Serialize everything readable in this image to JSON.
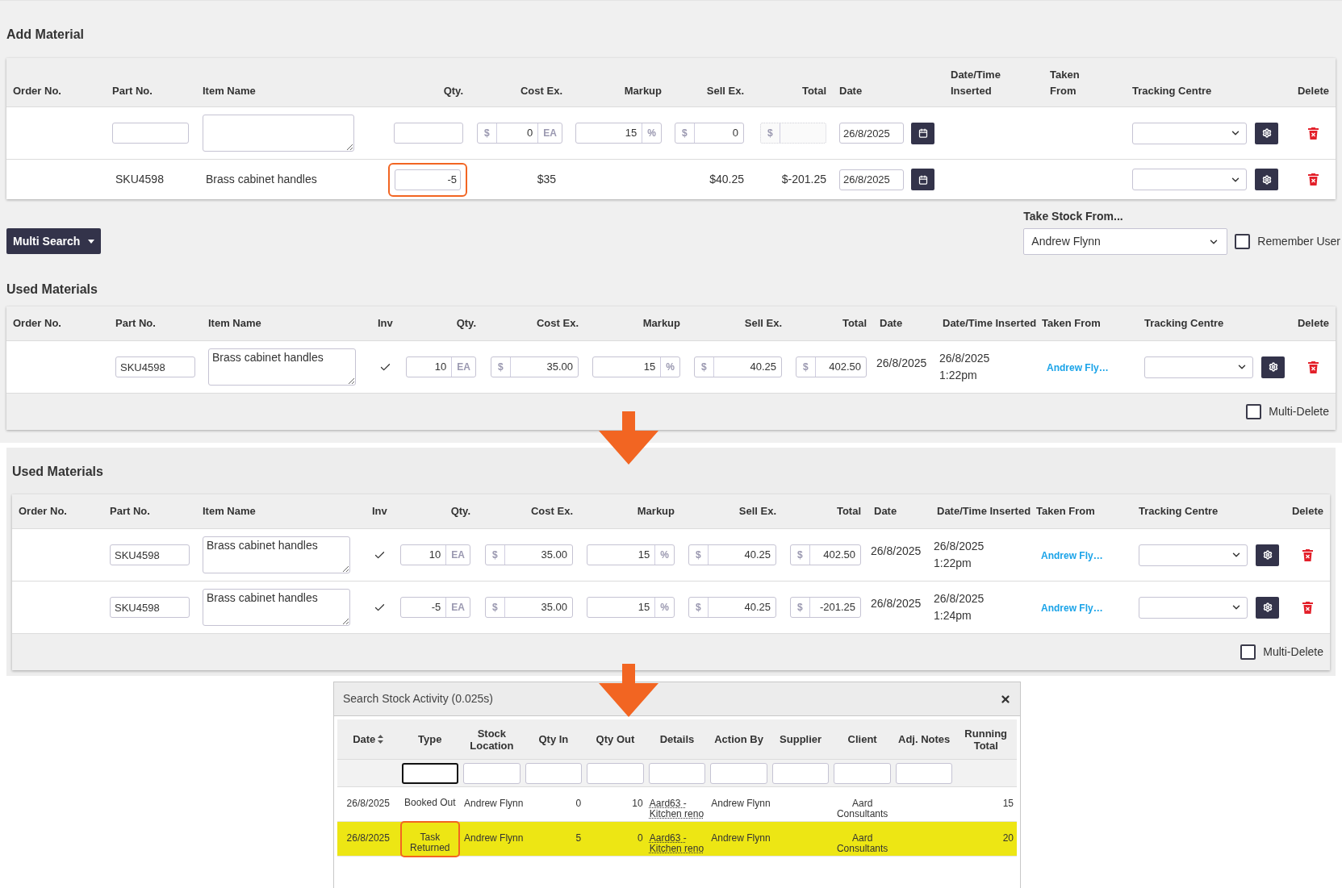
{
  "add_material": {
    "title": "Add Material",
    "columns": [
      "Order No.",
      "Part No.",
      "Item Name",
      "Qty.",
      "Cost Ex.",
      "Markup",
      "Sell Ex.",
      "Total",
      "Date",
      "Date/Time Inserted",
      "Taken From",
      "Tracking Centre",
      "Delete"
    ],
    "entry_row": {
      "cost_ex": {
        "prefix": "$",
        "value": "0",
        "suffix": "EA"
      },
      "markup": {
        "value": "15",
        "suffix": "%"
      },
      "sell_ex": {
        "prefix": "$",
        "value": "0"
      },
      "total": {
        "prefix": "$",
        "disabled": true
      },
      "date": "26/8/2025"
    },
    "rows": [
      {
        "part_no": "SKU4598",
        "item_name": "Brass cabinet handles",
        "qty": "-5",
        "qty_callout": true,
        "cost_ex": "$35",
        "sell_ex": "$40.25",
        "total": "$-201.25",
        "date": "26/8/2025"
      }
    ]
  },
  "multi_search": {
    "label": "Multi Search"
  },
  "take_stock_from": {
    "label": "Take Stock From...",
    "value": "Andrew Flynn",
    "remember_label": "Remember User",
    "remember_checked": false
  },
  "used_materials_before": {
    "title": "Used Materials",
    "columns": [
      "Order No.",
      "Part No.",
      "Item Name",
      "Inv",
      "Qty.",
      "Cost Ex.",
      "Markup",
      "Sell Ex.",
      "Total",
      "Date",
      "Date/Time Inserted",
      "Taken From",
      "Tracking Centre",
      "Delete"
    ],
    "rows": [
      {
        "part_no": "SKU4598",
        "item_name": "Brass cabinet handles",
        "inv_checked": true,
        "qty": {
          "value": "10",
          "suffix": "EA"
        },
        "cost_ex": {
          "prefix": "$",
          "value": "35.00"
        },
        "markup": {
          "value": "15",
          "suffix": "%"
        },
        "sell_ex": {
          "prefix": "$",
          "value": "40.25"
        },
        "total": {
          "prefix": "$",
          "value": "402.50"
        },
        "date": "26/8/2025",
        "inserted_date": "26/8/2025",
        "inserted_time": "1:22pm",
        "taken_from": "Andrew Fly…"
      }
    ],
    "multi_delete": {
      "label": "Multi-Delete",
      "checked": false
    }
  },
  "used_materials_after": {
    "title": "Used Materials",
    "columns": [
      "Order No.",
      "Part No.",
      "Item Name",
      "Inv",
      "Qty.",
      "Cost Ex.",
      "Markup",
      "Sell Ex.",
      "Total",
      "Date",
      "Date/Time Inserted",
      "Taken From",
      "Tracking Centre",
      "Delete"
    ],
    "rows": [
      {
        "part_no": "SKU4598",
        "item_name": "Brass cabinet handles",
        "inv_checked": true,
        "qty": {
          "value": "10",
          "suffix": "EA"
        },
        "cost_ex": {
          "prefix": "$",
          "value": "35.00"
        },
        "markup": {
          "value": "15",
          "suffix": "%"
        },
        "sell_ex": {
          "prefix": "$",
          "value": "40.25"
        },
        "total": {
          "prefix": "$",
          "value": "402.50"
        },
        "date": "26/8/2025",
        "inserted_date": "26/8/2025",
        "inserted_time": "1:22pm",
        "taken_from": "Andrew Fly…"
      },
      {
        "part_no": "SKU4598",
        "item_name": "Brass cabinet handles",
        "inv_checked": true,
        "qty": {
          "value": "-5",
          "suffix": "EA"
        },
        "cost_ex": {
          "prefix": "$",
          "value": "35.00"
        },
        "markup": {
          "value": "15",
          "suffix": "%"
        },
        "sell_ex": {
          "prefix": "$",
          "value": "40.25"
        },
        "total": {
          "prefix": "$",
          "value": "-201.25"
        },
        "date": "26/8/2025",
        "inserted_date": "26/8/2025",
        "inserted_time": "1:24pm",
        "taken_from": "Andrew Fly…"
      }
    ],
    "multi_delete": {
      "label": "Multi-Delete",
      "checked": false
    }
  },
  "stock_activity": {
    "title": "Search Stock Activity (0.025s)",
    "columns": [
      {
        "label": "Date",
        "sortable": true
      },
      {
        "label": "Type",
        "sortable": false
      },
      {
        "label": "Stock Location",
        "sortable": false
      },
      {
        "label": "Qty In",
        "sortable": false
      },
      {
        "label": "Qty Out",
        "sortable": false
      },
      {
        "label": "Details",
        "sortable": false
      },
      {
        "label": "Action By",
        "sortable": false
      },
      {
        "label": "Supplier",
        "sortable": false
      },
      {
        "label": "Client",
        "sortable": false
      },
      {
        "label": "Adj. Notes",
        "sortable": false
      },
      {
        "label": "Running Total",
        "sortable": false
      }
    ],
    "filters": [
      {
        "focused": true
      },
      {
        "focused": false
      },
      {
        "focused": false
      },
      {
        "focused": false
      },
      {
        "focused": false
      },
      {
        "focused": false
      },
      {
        "focused": false
      },
      {
        "focused": false
      },
      {
        "focused": false
      }
    ],
    "rows": [
      {
        "date": "26/8/2025",
        "type": "Booked Out",
        "type_callout": false,
        "stock_location": "Andrew Flynn",
        "qty_in": "0",
        "qty_out": "10",
        "details": "Aard63 - Kitchen reno",
        "action_by": "Andrew Flynn",
        "client": "Aard Consultants",
        "running_total": "15",
        "highlighted": false
      },
      {
        "date": "26/8/2025",
        "type": "Task Returned",
        "type_callout": true,
        "stock_location": "Andrew Flynn",
        "qty_in": "5",
        "qty_out": "0",
        "details": "Aard63 - Kitchen reno",
        "action_by": "Andrew Flynn",
        "client": "Aard Consultants",
        "running_total": "20",
        "highlighted": true
      }
    ]
  }
}
